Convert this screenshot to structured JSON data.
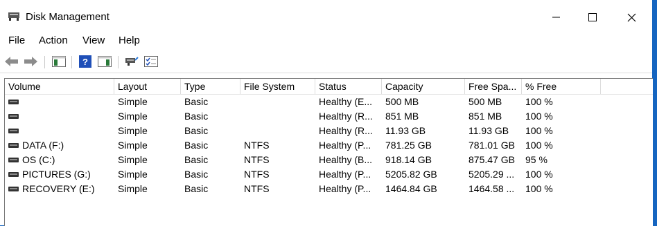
{
  "window": {
    "title": "Disk Management",
    "title_icon": "disk-management-icon"
  },
  "menu": [
    "File",
    "Action",
    "View",
    "Help"
  ],
  "toolbar": [
    "back-arrow-icon",
    "forward-arrow-icon",
    "console-tree-icon",
    "help-icon",
    "properties-pane-icon",
    "connect-icon",
    "checklist-icon"
  ],
  "columns": [
    "Volume",
    "Layout",
    "Type",
    "File System",
    "Status",
    "Capacity",
    "Free Spa...",
    "% Free"
  ],
  "rows": [
    {
      "volume": "",
      "layout": "Simple",
      "type": "Basic",
      "fs": "",
      "status": "Healthy (E...",
      "capacity": "500 MB",
      "free": "500 MB",
      "pct": "100 %"
    },
    {
      "volume": "",
      "layout": "Simple",
      "type": "Basic",
      "fs": "",
      "status": "Healthy (R...",
      "capacity": "851 MB",
      "free": "851 MB",
      "pct": "100 %"
    },
    {
      "volume": "",
      "layout": "Simple",
      "type": "Basic",
      "fs": "",
      "status": "Healthy (R...",
      "capacity": "11.93 GB",
      "free": "11.93 GB",
      "pct": "100 %"
    },
    {
      "volume": "DATA (F:)",
      "layout": "Simple",
      "type": "Basic",
      "fs": "NTFS",
      "status": "Healthy (P...",
      "capacity": "781.25 GB",
      "free": "781.01 GB",
      "pct": "100 %"
    },
    {
      "volume": "OS (C:)",
      "layout": "Simple",
      "type": "Basic",
      "fs": "NTFS",
      "status": "Healthy (B...",
      "capacity": "918.14 GB",
      "free": "875.47 GB",
      "pct": "95 %"
    },
    {
      "volume": "PICTURES (G:)",
      "layout": "Simple",
      "type": "Basic",
      "fs": "NTFS",
      "status": "Healthy (P...",
      "capacity": "5205.82 GB",
      "free": "5205.29 ...",
      "pct": "100 %"
    },
    {
      "volume": "RECOVERY (E:)",
      "layout": "Simple",
      "type": "Basic",
      "fs": "NTFS",
      "status": "Healthy (P...",
      "capacity": "1464.84 GB",
      "free": "1464.58 ...",
      "pct": "100 %"
    }
  ]
}
